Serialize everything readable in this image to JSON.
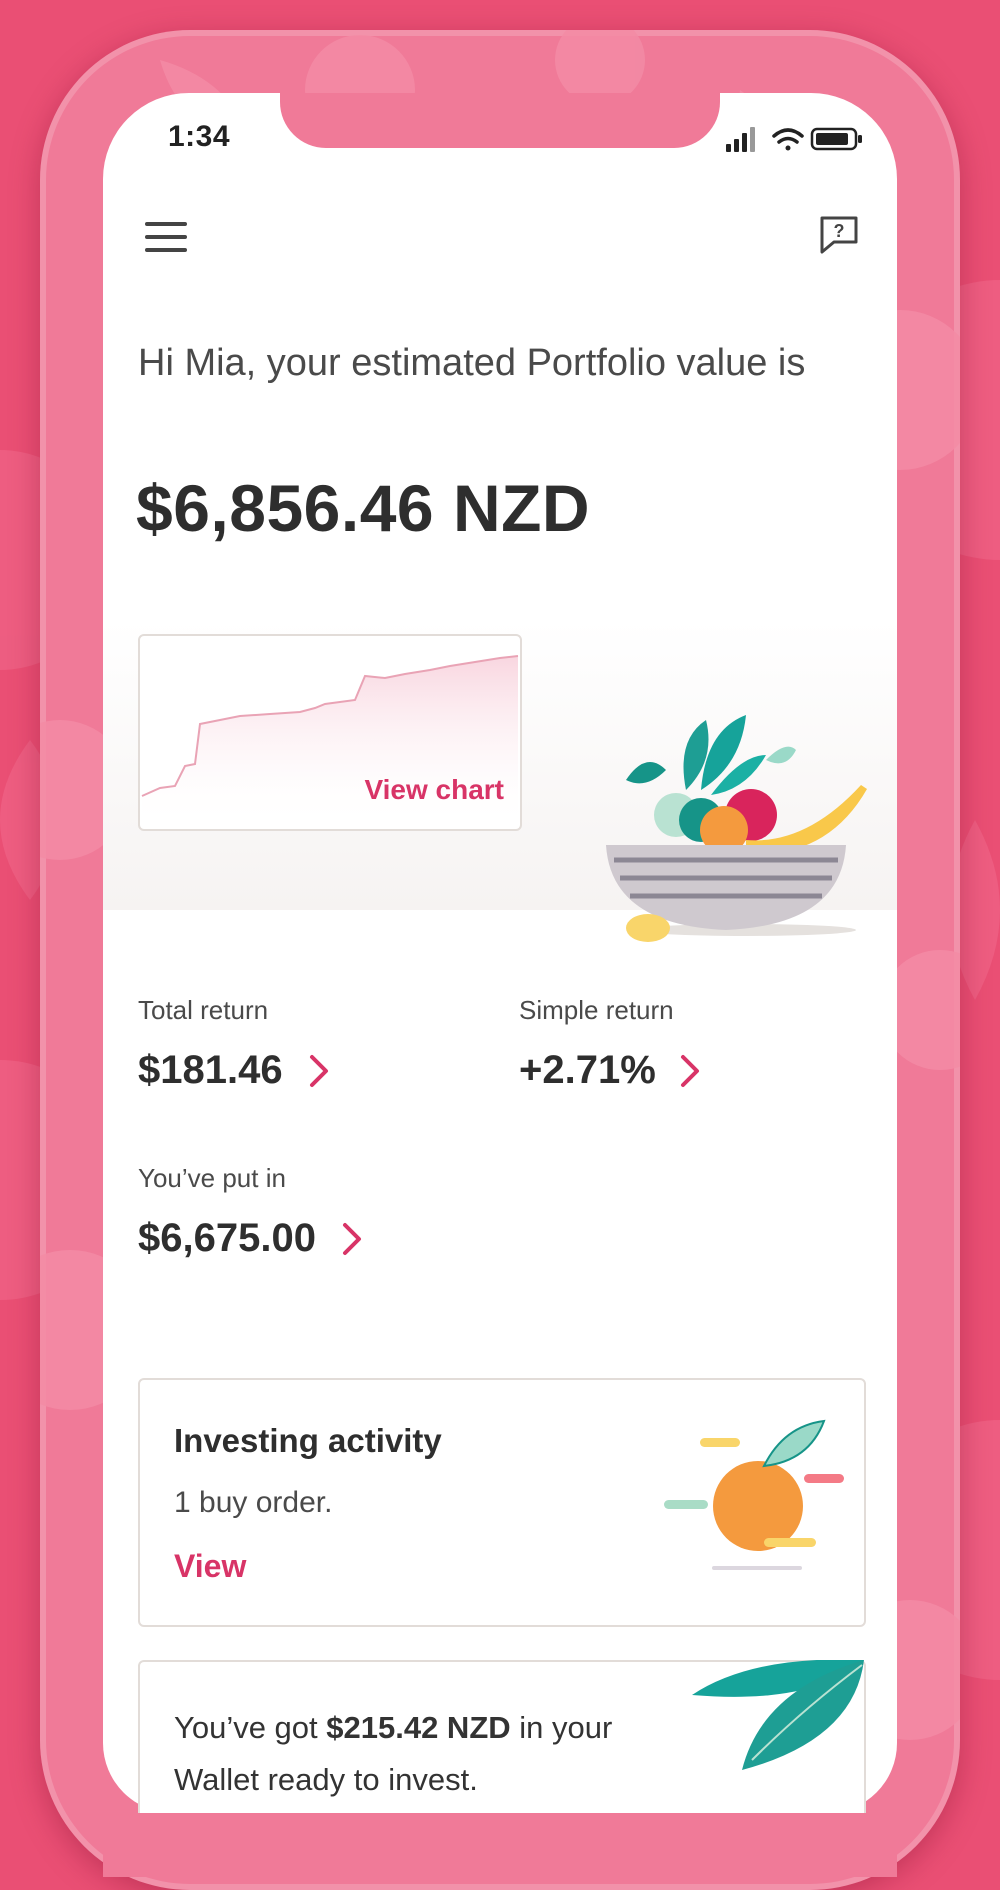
{
  "status_bar": {
    "time": "1:34"
  },
  "header": {
    "menu_icon": "hamburger-menu-icon",
    "help_icon": "help-chat-icon"
  },
  "greeting": "Hi Mia, your estimated Portfolio value is",
  "portfolio_value": "$6,856.46 NZD",
  "chart_card": {
    "link_label": "View chart"
  },
  "stats": {
    "total_return": {
      "label": "Total return",
      "value": "$181.46"
    },
    "simple_return": {
      "label": "Simple return",
      "value": "+2.71%"
    },
    "put_in": {
      "label": "You’ve put in",
      "value": "$6,675.00"
    }
  },
  "investing_activity": {
    "title": "Investing activity",
    "description": "1 buy order.",
    "link_label": "View"
  },
  "wallet": {
    "prefix": "You’ve got ",
    "amount": "$215.42 NZD",
    "suffix": " in your Wallet ready to invest."
  },
  "colors": {
    "background": "#ea4f74",
    "accent": "#d83467",
    "text_dark": "#2e2e2e"
  }
}
